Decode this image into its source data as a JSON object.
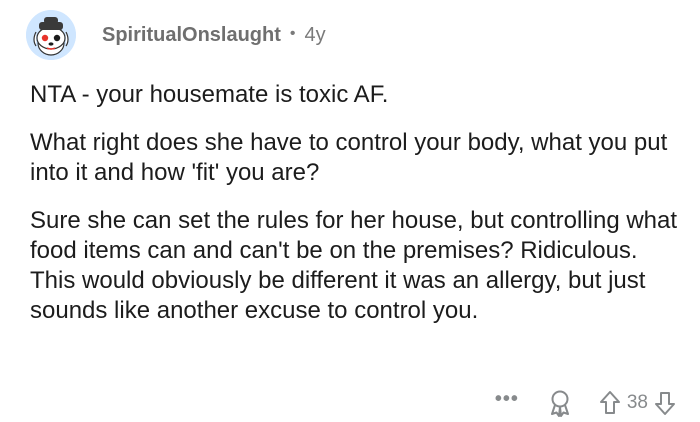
{
  "comment": {
    "author": "SpiritualOnslaught",
    "separator": "•",
    "age": "4y",
    "paragraphs": [
      "NTA - your housemate is toxic AF.",
      "What right does she have to control your body, what you put into it and how 'fit' you are?",
      "Sure she can set the rules for her house, but controlling what food items can and can't be on the premises? Ridiculous. This would obviously be different it was an allergy, but just sounds like another excuse to control you."
    ]
  },
  "actions": {
    "more_label": "•••",
    "score": "38",
    "icons": {
      "more": "more-dots-icon",
      "award": "award-icon",
      "upvote": "upvote-arrow-icon",
      "downvote": "downvote-arrow-icon"
    }
  },
  "colors": {
    "avatar_bg": "#cfe6ff",
    "meta_text": "#7a7a7a",
    "body_text": "#1c1c1c",
    "action_icons": "#878a8c"
  }
}
